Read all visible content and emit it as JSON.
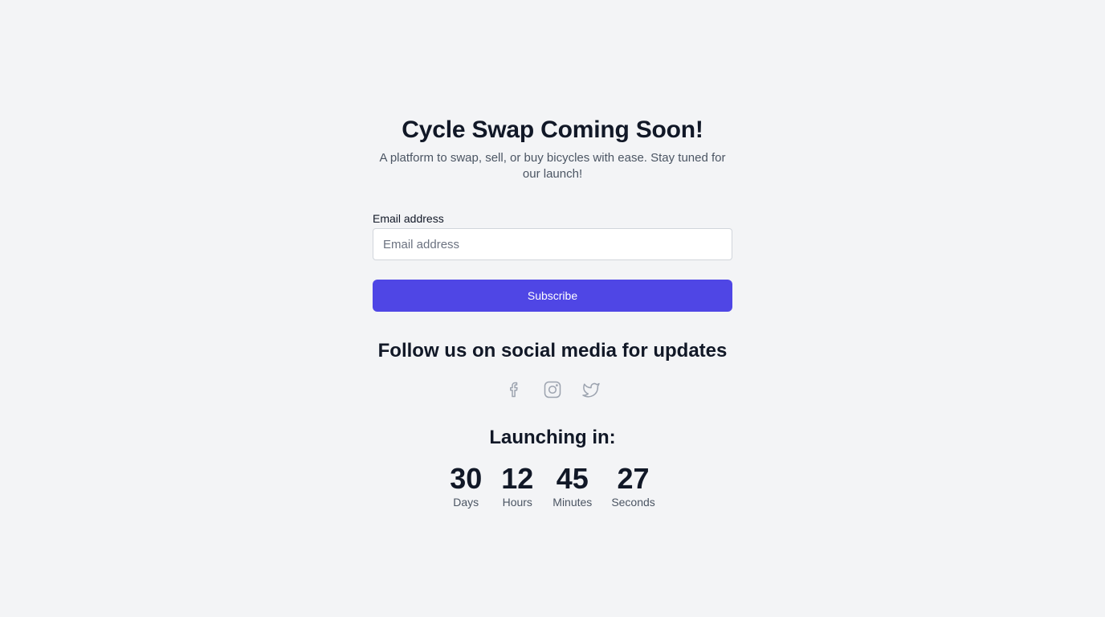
{
  "hero": {
    "title": "Cycle Swap Coming Soon!",
    "subtitle": "A platform to swap, sell, or buy bicycles with ease. Stay tuned for our launch!"
  },
  "form": {
    "email_label": "Email address",
    "email_placeholder": "Email address",
    "email_value": "",
    "subscribe_label": "Subscribe"
  },
  "social": {
    "title": "Follow us on social media for updates",
    "icons": [
      "facebook-icon",
      "instagram-icon",
      "twitter-icon"
    ],
    "icon_color": "#9ca3af"
  },
  "countdown": {
    "title": "Launching in:",
    "units": [
      {
        "value": "30",
        "label": "Days"
      },
      {
        "value": "12",
        "label": "Hours"
      },
      {
        "value": "45",
        "label": "Minutes"
      },
      {
        "value": "27",
        "label": "Seconds"
      }
    ]
  },
  "colors": {
    "background": "#f3f4f6",
    "accent": "#4f46e5",
    "heading": "#111827",
    "muted": "#4b5563"
  }
}
